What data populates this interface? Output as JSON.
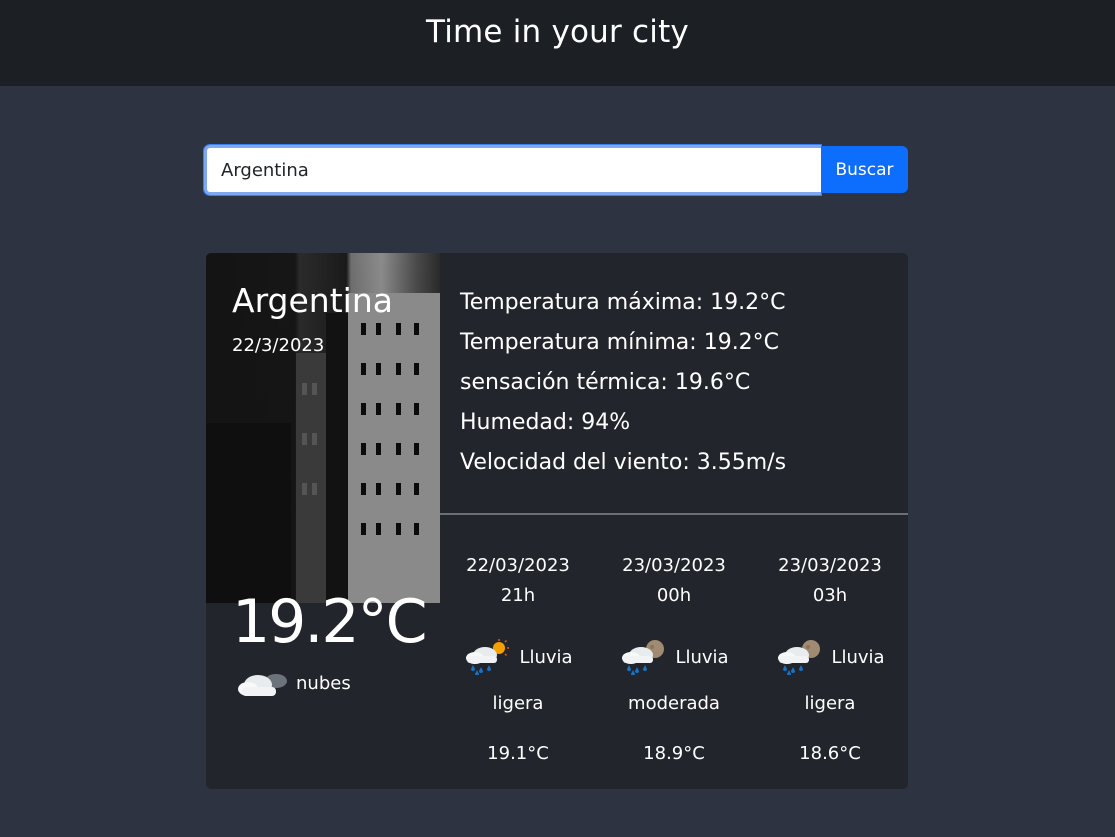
{
  "header": {
    "title": "Time in your city"
  },
  "search": {
    "value": "Argentina",
    "button_label": "Buscar"
  },
  "current": {
    "city": "Argentina",
    "date": "22/3/2023",
    "temperature": "19.2°C",
    "condition": "nubes",
    "condition_icon": "cloud-icon"
  },
  "stats": {
    "max": "Temperatura máxima: 19.2°C",
    "min": "Temperatura mínima: 19.2°C",
    "feels": "sensación térmica: 19.6°C",
    "humidity": "Humedad: 94%",
    "wind": "Velocidad del viento: 3.55m/s"
  },
  "forecast": [
    {
      "date": "22/03/2023",
      "hour": "21h",
      "desc1": "Lluvia",
      "desc2": "ligera",
      "temp": "19.1°C",
      "icon": "rain-sun-icon"
    },
    {
      "date": "23/03/2023",
      "hour": "00h",
      "desc1": "Lluvia",
      "desc2": "moderada",
      "temp": "18.9°C",
      "icon": "rain-moon-icon"
    },
    {
      "date": "23/03/2023",
      "hour": "03h",
      "desc1": "Lluvia",
      "desc2": "ligera",
      "temp": "18.6°C",
      "icon": "rain-moon-icon"
    }
  ],
  "colors": {
    "page_bg": "#2d3341",
    "header_bg": "#1c1f24",
    "card_bg": "#22252b",
    "button_bg": "#0d6efd"
  }
}
